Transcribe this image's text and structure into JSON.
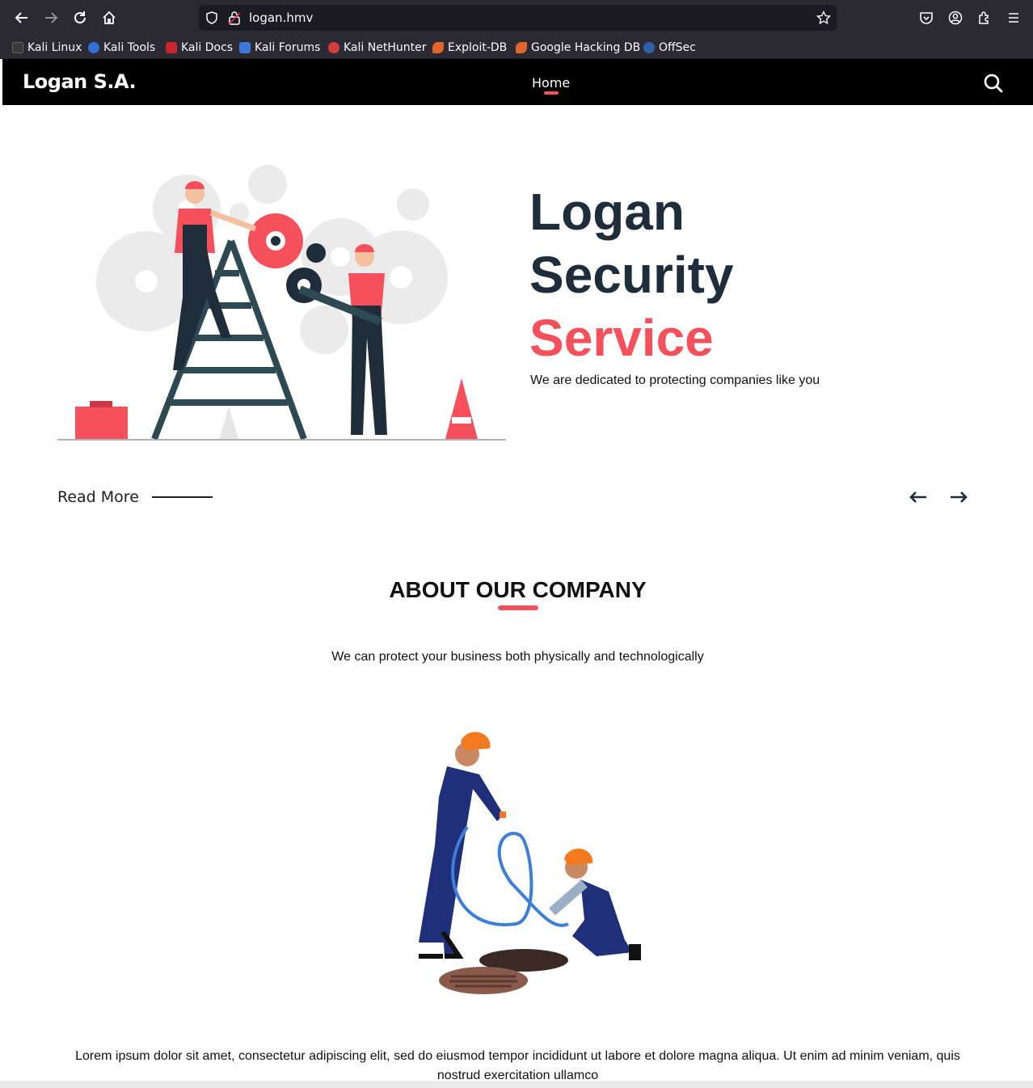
{
  "browser": {
    "url": "logan.hmv",
    "bookmarks": [
      {
        "label": "Kali Linux",
        "icon": "kali-dragon-icon"
      },
      {
        "label": "Kali Tools",
        "icon": "kali-tools-icon"
      },
      {
        "label": "Kali Docs",
        "icon": "kali-docs-icon"
      },
      {
        "label": "Kali Forums",
        "icon": "kali-forums-icon"
      },
      {
        "label": "Kali NetHunter",
        "icon": "nethunter-icon"
      },
      {
        "label": "Exploit-DB",
        "icon": "exploit-db-icon"
      },
      {
        "label": "Google Hacking DB",
        "icon": "ghdb-icon"
      },
      {
        "label": "OffSec",
        "icon": "offsec-icon"
      }
    ]
  },
  "navbar": {
    "brand": "Logan S.A.",
    "home_label": "Home"
  },
  "hero": {
    "title_line1": "Logan",
    "title_line2": "Security",
    "title_line3": "Service",
    "subtitle": "We are dedicated to protecting companies like you",
    "read_more": "Read More"
  },
  "about": {
    "title": "ABOUT OUR COMPANY",
    "subtitle": "We can protect your business both physically and technologically",
    "body": "Lorem ipsum dolor sit amet, consectetur adipiscing elit, sed do eiusmod tempor incididunt ut labore et dolore magna aliqua. Ut enim ad minim veniam, quis nostrud exercitation ullamco"
  },
  "colors": {
    "accent": "#f6505c",
    "dark_text": "#1e2d39",
    "navbar_bg": "#000000",
    "browser_bg": "#2b2a33"
  }
}
